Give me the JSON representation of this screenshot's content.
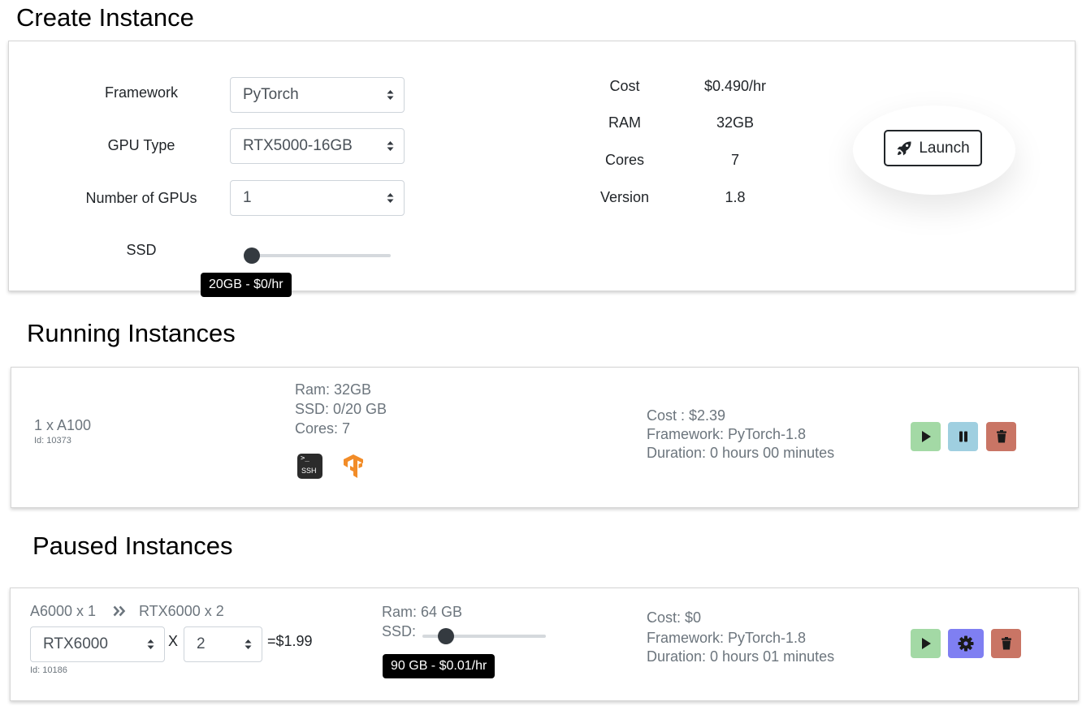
{
  "create": {
    "title": "Create Instance",
    "framework_label": "Framework",
    "framework_value": "PyTorch",
    "gpu_type_label": "GPU Type",
    "gpu_type_value": "RTX5000-16GB",
    "num_gpus_label": "Number of GPUs",
    "num_gpus_value": "1",
    "ssd_label": "SSD",
    "ssd_slider_level": 0,
    "ssd_tooltip": "20GB - $0/hr",
    "specs": [
      {
        "label": "Cost",
        "value": "$0.490/hr"
      },
      {
        "label": "RAM",
        "value": "32GB"
      },
      {
        "label": "Cores",
        "value": "7"
      },
      {
        "label": "Version",
        "value": "1.8"
      }
    ],
    "launch_label": "Launch",
    "launch_icon": "rocket-icon"
  },
  "running": {
    "title": "Running Instances",
    "instances": [
      {
        "gpu": "1 x A100",
        "id": "Id: 10373",
        "ram": "Ram: 32GB",
        "ssd": "SSD: 0/20 GB",
        "cores": "Cores: 7",
        "ssh_icon": "ssh-terminal-icon",
        "ssh_icon_text": "SSH",
        "framework_icon": "tensorflow-icon",
        "cost": "Cost : $2.39",
        "framework": "Framework: PyTorch-1.8",
        "duration": "Duration: 0 hours 00 minutes",
        "actions": [
          "play-icon",
          "pause-icon",
          "trash-icon"
        ]
      }
    ]
  },
  "paused": {
    "title": "Paused Instances",
    "instances": [
      {
        "from_gpu": "A6000 x 1",
        "arrow_icon": "double-chevron-right-icon",
        "to_gpu": "RTX6000 x 2",
        "gpu_select_value": "RTX6000",
        "times": "X",
        "count_select_value": "2",
        "price": "=$1.99",
        "id": "Id: 10186",
        "ram": "Ram: 64 GB",
        "ssd_label": "SSD:",
        "ssd_slider_level": 0.18,
        "ssd_tooltip": "90 GB - $0.01/hr",
        "cost": "Cost: $0",
        "framework": "Framework: PyTorch-1.8",
        "duration": "Duration: 0 hours 01 minutes",
        "actions": [
          "play-icon",
          "gear-icon",
          "trash-icon"
        ]
      }
    ]
  },
  "colors": {
    "play": "#a3d9a5",
    "pause": "#9fcfe0",
    "delete": "#c97565",
    "settings": "#7f7ff2",
    "tensorflow": "#f28c28"
  }
}
